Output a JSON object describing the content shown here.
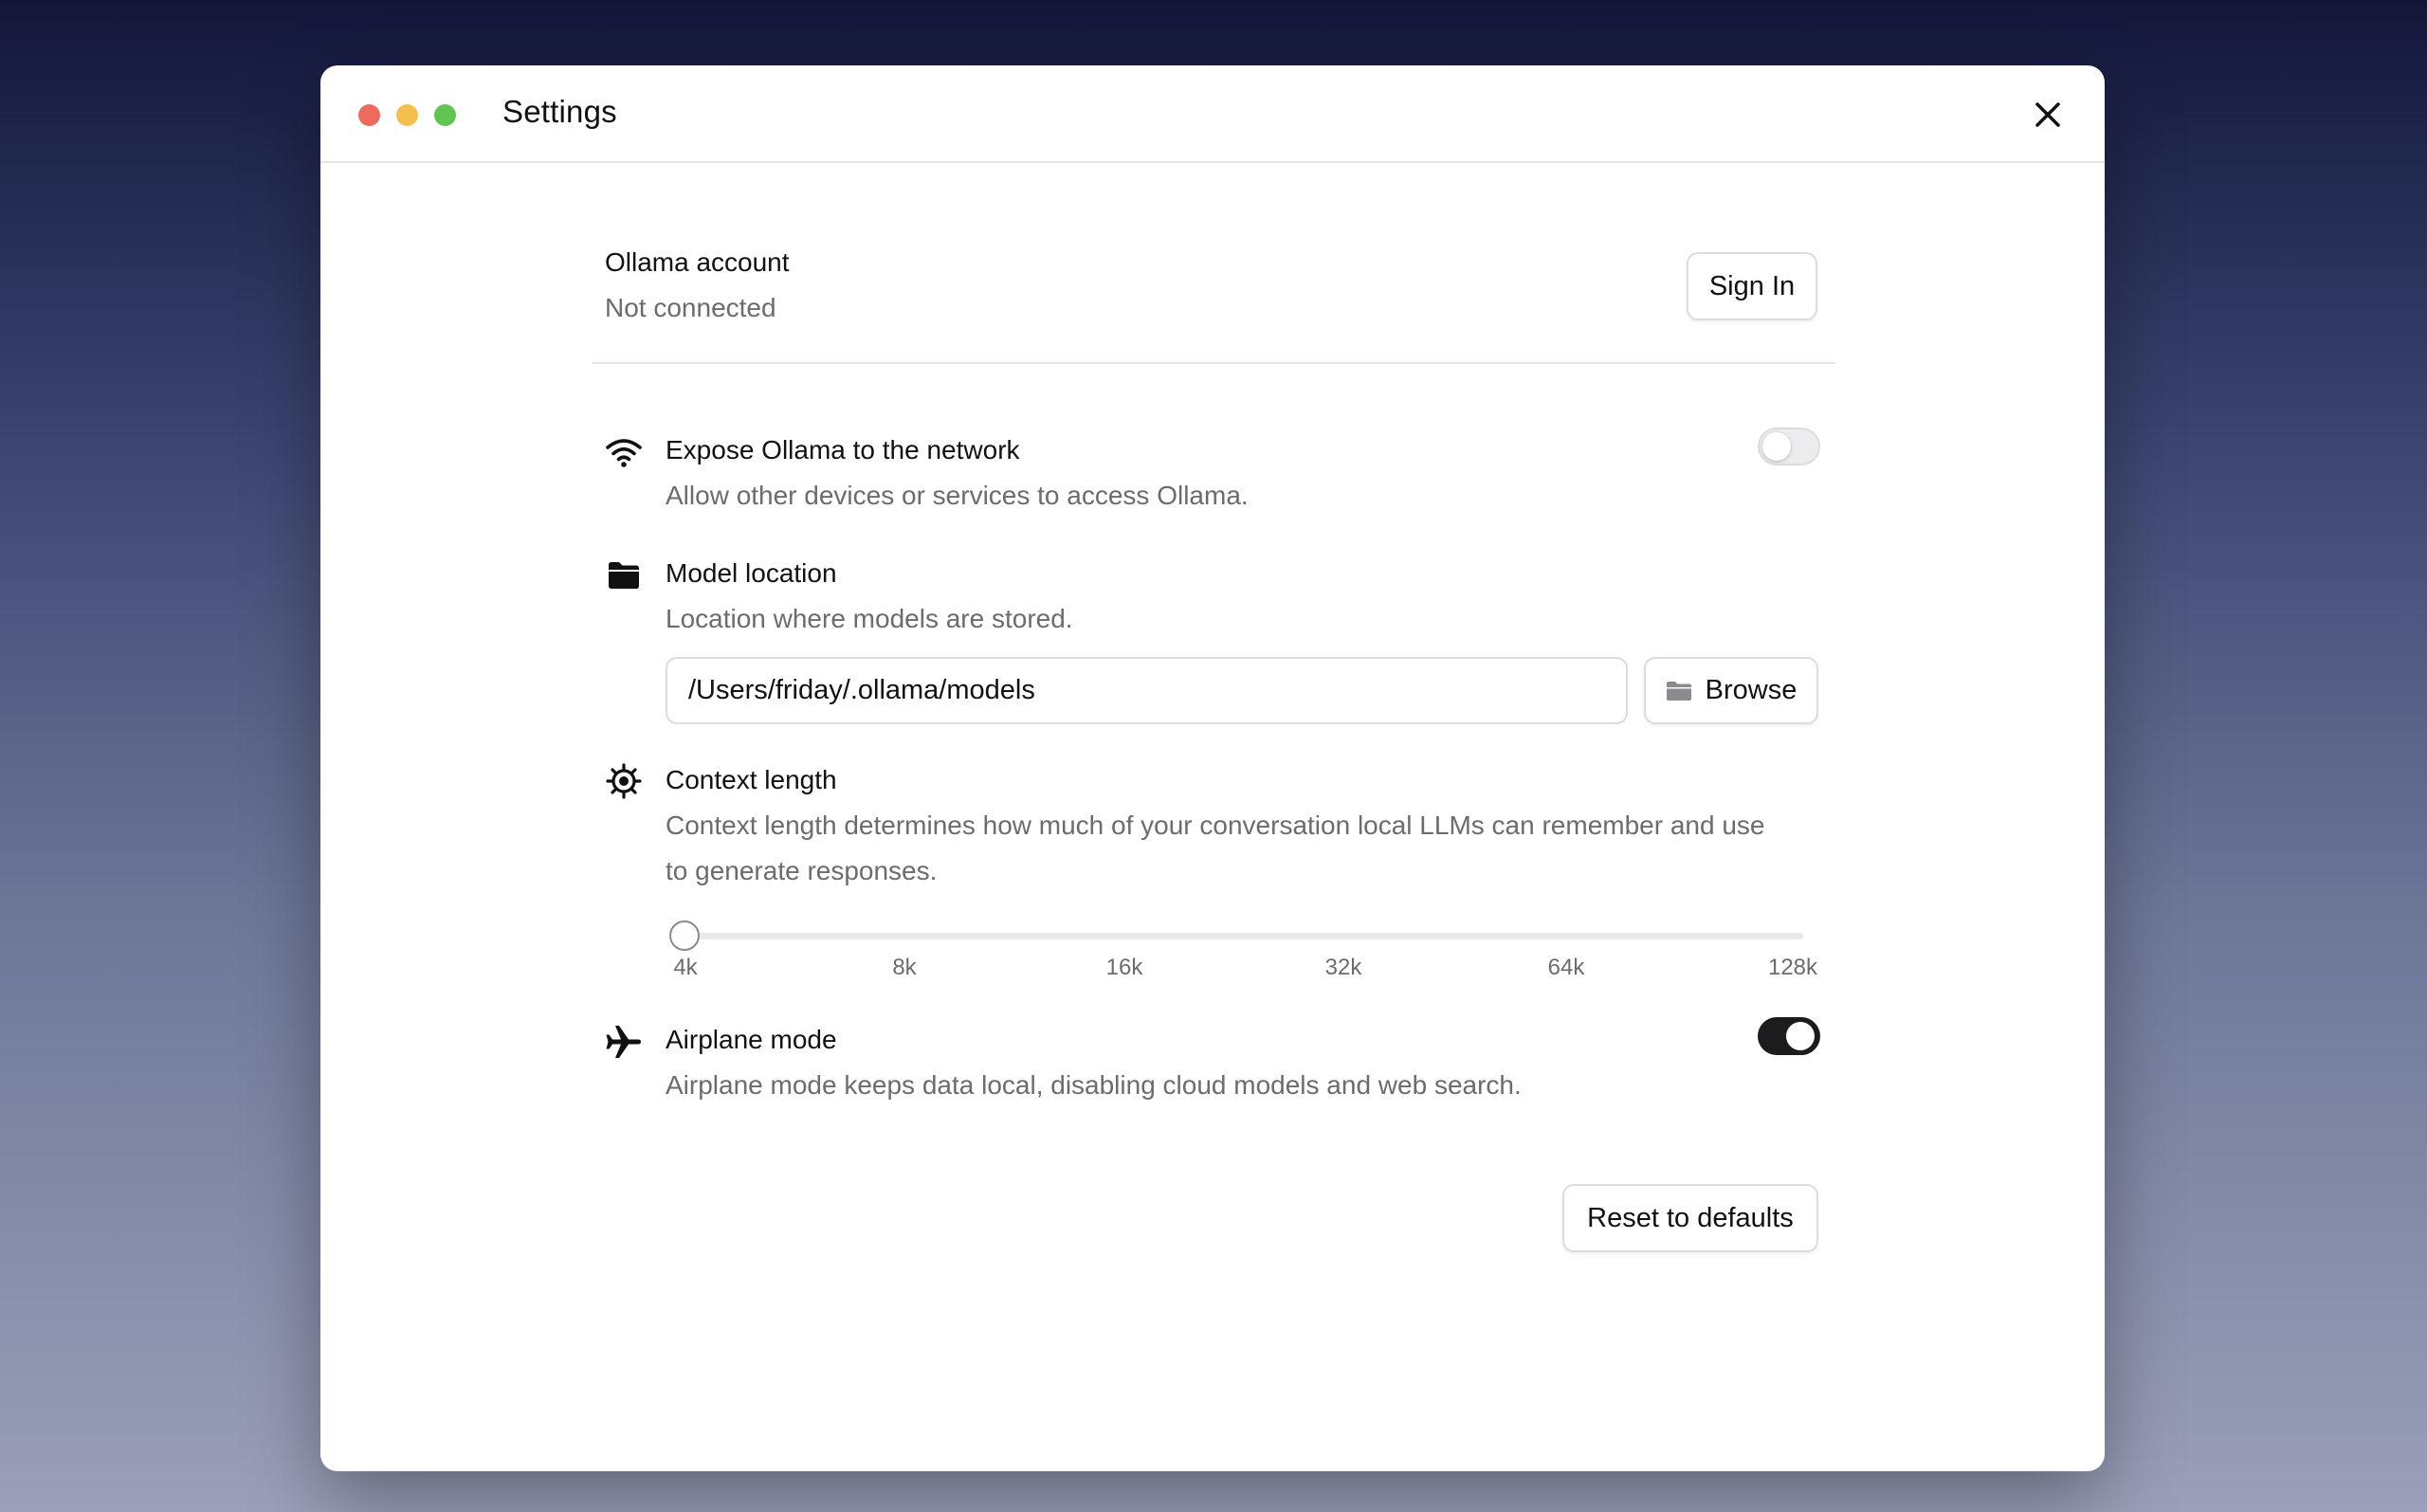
{
  "window": {
    "title": "Settings"
  },
  "account": {
    "title": "Ollama account",
    "status": "Not connected",
    "sign_in_label": "Sign In"
  },
  "network": {
    "title": "Expose Ollama to the network",
    "description": "Allow other devices or services to access Ollama.",
    "enabled": false,
    "icon": "wifi-icon"
  },
  "model_location": {
    "title": "Model location",
    "description": "Location where models are stored.",
    "path": "/Users/friday/.ollama/models",
    "browse_label": "Browse",
    "icon": "folder-icon"
  },
  "context_length": {
    "title": "Context length",
    "description_line1": "Context length determines how much of your conversation local LLMs can remember and use",
    "description_line2": "to generate responses.",
    "ticks": [
      "4k",
      "8k",
      "16k",
      "32k",
      "64k",
      "128k"
    ],
    "selected": "4k",
    "icon": "gear-icon"
  },
  "airplane": {
    "title": "Airplane mode",
    "description": "Airplane mode keeps data local, disabling cloud models and web search.",
    "enabled": true,
    "icon": "airplane-icon"
  },
  "reset_label": "Reset to defaults"
}
